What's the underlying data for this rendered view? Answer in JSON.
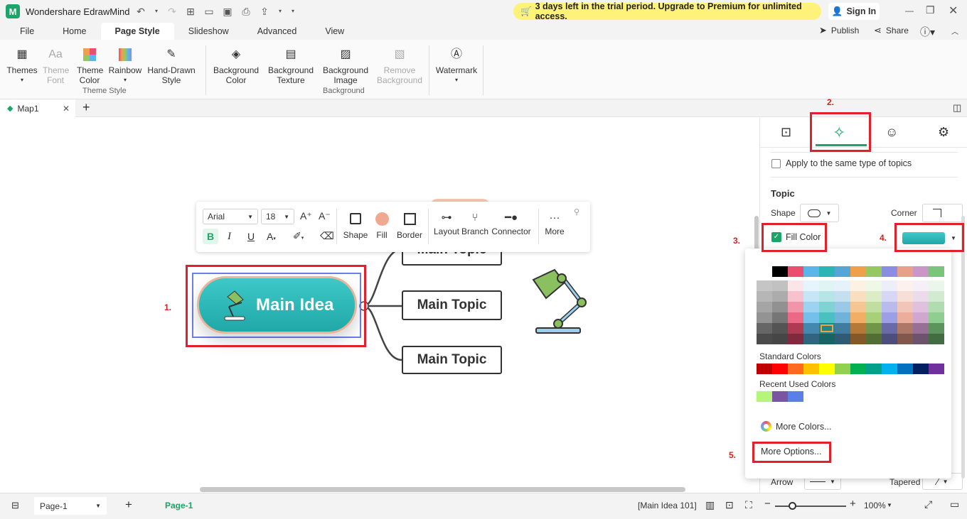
{
  "app": {
    "title": "Wondershare EdrawMind",
    "trial_banner": "3 days left in the trial period. Upgrade to Premium for unlimited access.",
    "sign_in": "Sign In"
  },
  "menu": {
    "items": [
      "File",
      "Home",
      "Page Style",
      "Slideshow",
      "Advanced",
      "View"
    ],
    "active": "Page Style",
    "publish": "Publish",
    "share": "Share"
  },
  "ribbon": {
    "theme_style": {
      "label": "Theme Style",
      "buttons": [
        {
          "label": "Themes"
        },
        {
          "label": "Theme Font"
        },
        {
          "label": "Theme Color"
        },
        {
          "label": "Rainbow"
        },
        {
          "label": "Hand-Drawn Style"
        }
      ]
    },
    "background": {
      "label": "Background",
      "buttons": [
        {
          "label": "Background Color"
        },
        {
          "label": "Background Texture"
        },
        {
          "label": "Background Image"
        },
        {
          "label": "Remove Background"
        }
      ]
    },
    "watermark": "Watermark"
  },
  "doc_tab": {
    "name": "Map1"
  },
  "float_toolbar": {
    "font": "Arial",
    "size": "18",
    "labels": [
      "Shape",
      "Fill",
      "Border",
      "Layout",
      "Branch",
      "Connector",
      "More"
    ]
  },
  "mindmap": {
    "main_idea": "Main Idea",
    "topics": [
      "Main Topic",
      "Main Topic",
      "Main Topic"
    ]
  },
  "steps": [
    "1.",
    "2.",
    "3.",
    "4.",
    "5."
  ],
  "panel": {
    "apply_same": "Apply to the same type of topics",
    "section": "Topic",
    "shape_label": "Shape",
    "corner_label": "Corner",
    "fill_color_label": "Fill Color",
    "arrow_label": "Arrow",
    "tapered_label": "Tapered"
  },
  "color_picker": {
    "standard_label": "Standard Colors",
    "recent_label": "Recent Used Colors",
    "more_colors": "More Colors...",
    "more_options": "More Options...",
    "top_row": [
      "#ffffff",
      "#000000",
      "#e94f6f",
      "#5bb5e8",
      "#2bb5b5",
      "#55a5d5",
      "#f0a04a",
      "#97c860",
      "#8a8ee0",
      "#e8a08a",
      "#c897c7",
      "#7cc47c"
    ],
    "standard": [
      "#c00000",
      "#ff0000",
      "#ff6a1f",
      "#ffc000",
      "#ffff00",
      "#92d050",
      "#00b050",
      "#00a08a",
      "#00b0f0",
      "#0070c0",
      "#002060",
      "#7030a0"
    ],
    "recent": [
      "#b5f57a",
      "#7a55a0",
      "#5a80e8"
    ]
  },
  "status": {
    "page_tab": "Page-1",
    "page_active": "Page-1",
    "selection": "[Main Idea 101]",
    "zoom": "100%"
  }
}
